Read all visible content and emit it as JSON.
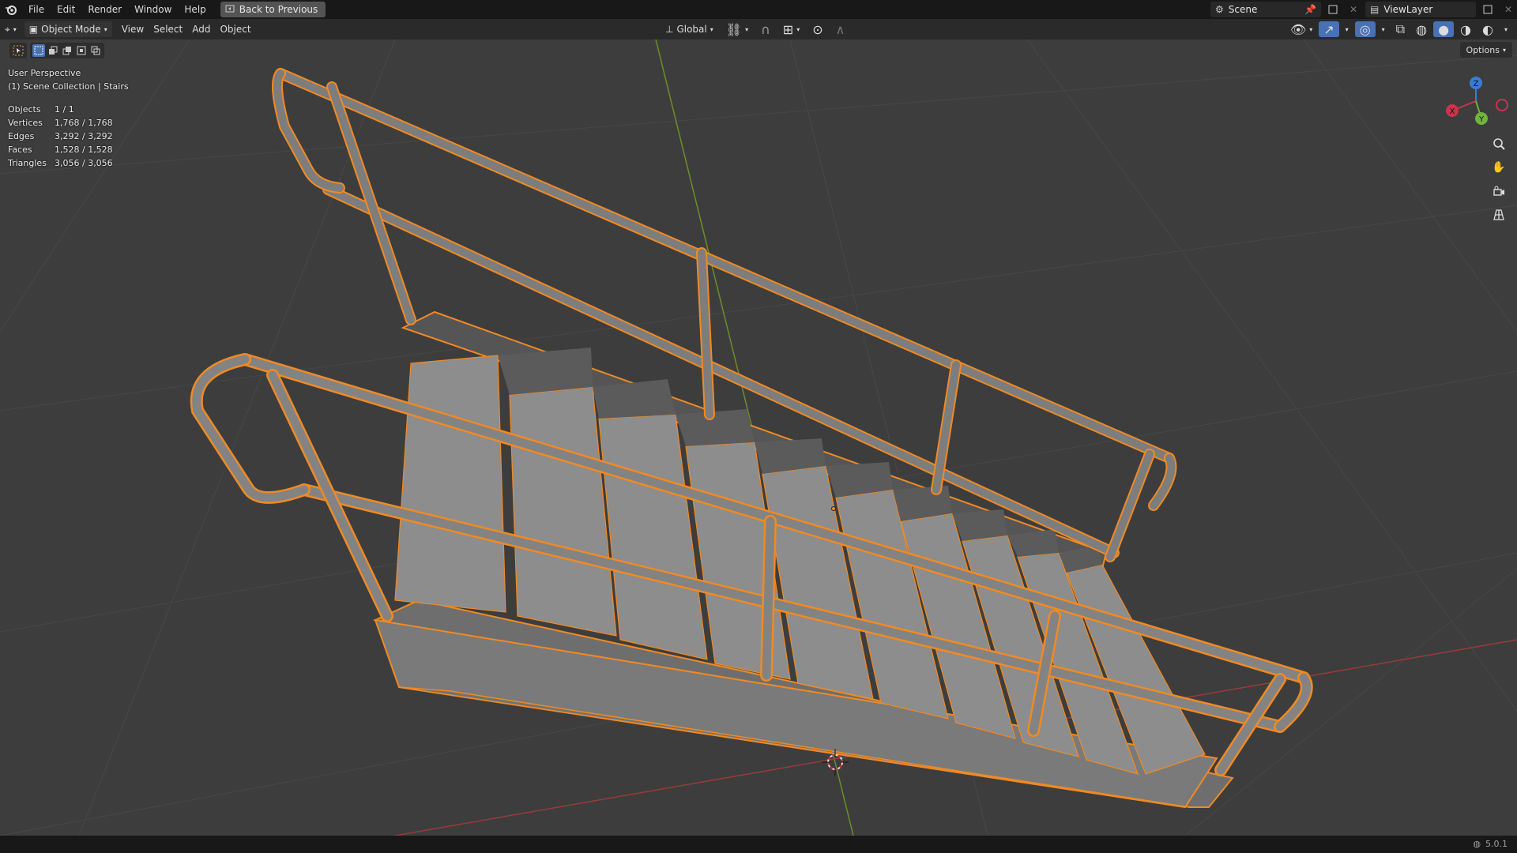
{
  "menubar": {
    "items": [
      "File",
      "Edit",
      "Render",
      "Window",
      "Help"
    ],
    "back_label": "Back to Previous",
    "scene_name": "Scene",
    "view_layer": "ViewLayer"
  },
  "header": {
    "mode": "Object Mode",
    "menus": [
      "View",
      "Select",
      "Add",
      "Object"
    ],
    "transform_orientation": "Global",
    "options_label": "Options"
  },
  "viewport": {
    "perspective": "User Perspective",
    "collection": "(1) Scene Collection | Stairs",
    "stats": [
      {
        "label": "Objects",
        "value": "1 / 1"
      },
      {
        "label": "Vertices",
        "value": "1,768 / 1,768"
      },
      {
        "label": "Edges",
        "value": "3,292 / 3,292"
      },
      {
        "label": "Faces",
        "value": "1,528 / 1,528"
      },
      {
        "label": "Triangles",
        "value": "3,056 / 3,056"
      }
    ],
    "selection_color": "#f08a24",
    "mesh_color": "#8a8a8a"
  },
  "gizmo": {
    "x": "X",
    "y": "Y",
    "z": "Z"
  },
  "statusbar": {
    "version": "5.0.1"
  }
}
